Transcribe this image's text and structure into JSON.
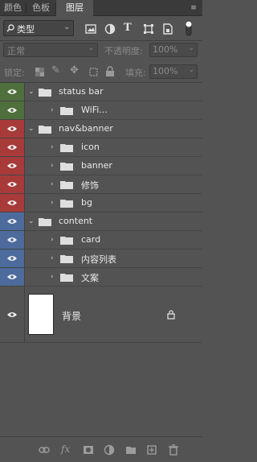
{
  "tabs": [
    {
      "label": "颜色"
    },
    {
      "label": "色板"
    },
    {
      "label": "图层"
    }
  ],
  "filter": {
    "kind_selected": "类型",
    "icons": [
      "image-filter-icon",
      "adjustment-filter-icon",
      "type-filter-icon",
      "shape-filter-icon",
      "smart-object-filter-icon",
      "filter-toggle-icon"
    ]
  },
  "blend": {
    "mode": "正常",
    "opacity_label": "不透明度:",
    "opacity_value": "100%"
  },
  "lock": {
    "label": "锁定:",
    "fill_label": "填充:",
    "fill_value": "100%"
  },
  "layers": [
    {
      "name": "status bar",
      "type": "group",
      "expanded": true,
      "color": "green"
    },
    {
      "name": "WiFi...",
      "type": "group",
      "expanded": false,
      "color": "green"
    },
    {
      "name": "nav&banner",
      "type": "group",
      "expanded": true,
      "color": "red"
    },
    {
      "name": "icon",
      "type": "group",
      "expanded": false,
      "color": "red"
    },
    {
      "name": "banner",
      "type": "group",
      "expanded": false,
      "color": "red"
    },
    {
      "name": "修饰",
      "type": "group",
      "expanded": false,
      "color": "red"
    },
    {
      "name": "bg",
      "type": "group",
      "expanded": false,
      "color": "red"
    },
    {
      "name": "content",
      "type": "group",
      "expanded": true,
      "color": "blue"
    },
    {
      "name": "card",
      "type": "group",
      "expanded": false,
      "color": "blue"
    },
    {
      "name": "内容列表",
      "type": "group",
      "expanded": false,
      "color": "blue"
    },
    {
      "name": "文案",
      "type": "group",
      "expanded": false,
      "color": "blue"
    }
  ],
  "background_layer": {
    "name": "背景",
    "locked": true
  },
  "colors": {
    "panel": "#535353",
    "green": "#4f6f3c",
    "red": "#a83a3a",
    "blue": "#4d6b9c"
  }
}
